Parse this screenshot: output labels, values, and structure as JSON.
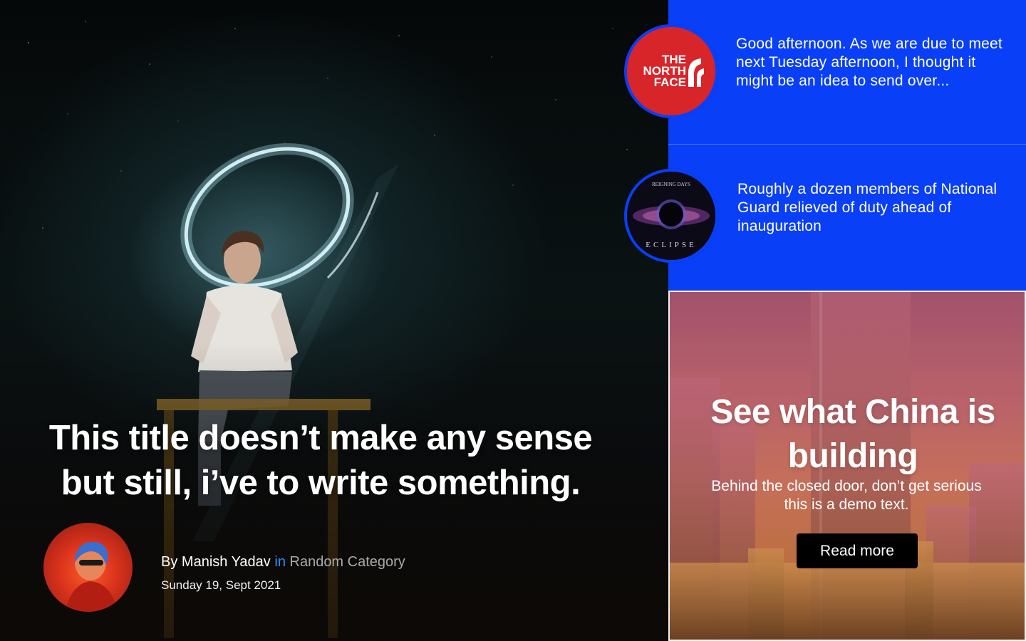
{
  "hero": {
    "title": "This title doesn’t make any sense but still, i’ve to write something.",
    "byline_prefix": "By ",
    "author": "Manish Yadav",
    "byline_in": " in ",
    "category": "Random Category",
    "date": "Sunday 19, Sept 2021"
  },
  "side_list": {
    "items": [
      {
        "logo": "the-north-face-logo",
        "logo_text": [
          "THE",
          "NORTH",
          "FACE"
        ],
        "text": "Good afternoon. As we are due to meet next Tuesday afternoon, I thought it might be an idea to send over..."
      },
      {
        "logo": "eclipse-album-cover",
        "logo_top_text": "REIGNING DAYS",
        "logo_bottom_text": "ECLIPSE",
        "text": "Roughly a dozen members of National Guard relieved of duty ahead of inauguration"
      }
    ]
  },
  "promo": {
    "title": "See what China is building",
    "subtitle": "Behind the closed door, don’t get serious this is a demo text.",
    "button_label": "Read more"
  },
  "colors": {
    "side_background": "#0a3ff8",
    "byline_in": "#2f8cff",
    "byline_category": "#a9a9a9",
    "north_face_red": "#d8252a",
    "button": "#000000"
  }
}
